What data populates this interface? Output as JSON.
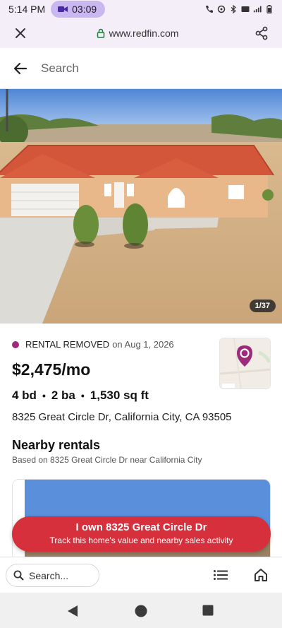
{
  "status_bar": {
    "time": "5:14 PM",
    "call_timer": "03:09"
  },
  "browser": {
    "url": "www.redfin.com"
  },
  "search_header": {
    "label": "Search"
  },
  "photo": {
    "counter": "1/37"
  },
  "listing": {
    "status": "RENTAL REMOVED",
    "status_date": "on Aug 1, 2026",
    "status_color": "#9d2a7a",
    "price": "$2,475/mo",
    "beds": "4 bd",
    "baths": "2 ba",
    "sqft": "1,530 sq ft",
    "separator": "•",
    "address": "8325 Great Circle Dr, California City, CA 93505"
  },
  "nearby": {
    "title": "Nearby rentals",
    "subtitle": "Based on 8325 Great Circle Dr near California City"
  },
  "cta": {
    "title": "I own 8325 Great Circle Dr",
    "subtitle": "Track this home's value and nearby sales activity",
    "color": "#d7303d"
  },
  "bottom_nav": {
    "search_placeholder": "Search..."
  },
  "icons": {
    "close": "close-icon",
    "lock": "lock-icon",
    "share": "share-icon",
    "back": "back-arrow-icon",
    "search": "search-icon",
    "list": "list-icon",
    "home": "home-icon",
    "map_pin": "map-pin-icon"
  }
}
